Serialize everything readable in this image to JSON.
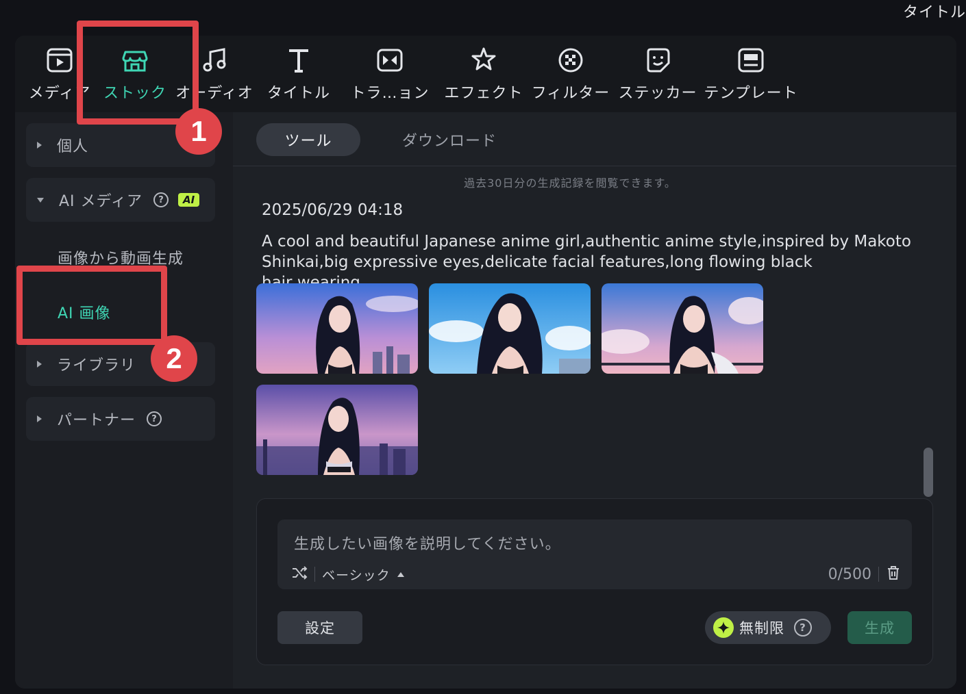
{
  "window_title": "タイトル",
  "toolbar": {
    "items": [
      {
        "label": "メディア",
        "icon": "media-icon"
      },
      {
        "label": "ストック",
        "icon": "store-icon"
      },
      {
        "label": "オーディオ",
        "icon": "music-note-icon"
      },
      {
        "label": "タイトル",
        "icon": "title-t-icon"
      },
      {
        "label": "トラ…ョン",
        "icon": "transition-icon"
      },
      {
        "label": "エフェクト",
        "icon": "effect-star-icon"
      },
      {
        "label": "フィルター",
        "icon": "filter-icon"
      },
      {
        "label": "ステッカー",
        "icon": "sticker-icon"
      },
      {
        "label": "テンプレート",
        "icon": "template-icon"
      }
    ],
    "active_index": 1
  },
  "sidebar": {
    "personal": "個人",
    "ai_media": "AI メディア",
    "ai_badge": "AI",
    "sub_items": [
      "画像から動画生成",
      "AI 画像"
    ],
    "library": "ライブラリ",
    "partner": "パートナー"
  },
  "content": {
    "tabs": [
      "ツール",
      "ダウンロード"
    ],
    "notice": "過去30日分の生成記録を閲覧できます。",
    "record": {
      "date": "2025/06/29 04:18",
      "prompt_line1": "A cool and beautiful Japanese anime girl,authentic anime style,inspired by Makoto",
      "prompt_line2": "Shinkai,big expressive eyes,delicate facial features,long flowing black hair,wearing..."
    }
  },
  "generator": {
    "placeholder": "生成したい画像を説明してください。",
    "mode": "ベーシック",
    "counter": "0/500",
    "settings_label": "設定",
    "unlimited_label": "無制限",
    "generate_label": "生成"
  },
  "annotations": {
    "callout1": "1",
    "callout2": "2"
  },
  "colors": {
    "accent": "#3fd6b4",
    "highlight": "#e0454a",
    "ai_badge": "#bff046"
  }
}
